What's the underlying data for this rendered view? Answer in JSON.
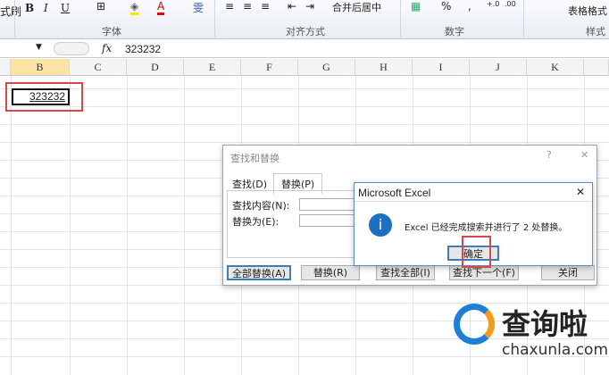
{
  "ribbon": {
    "bold": "B",
    "italic": "I",
    "underline": "U",
    "brush_tail": "式刷",
    "merge_center": "合并后居中",
    "percent": "%",
    "comma": ",",
    "table_format": "表格格式",
    "groups": {
      "font": "字体",
      "alignment": "对齐方式",
      "number": "数字",
      "styles": "样式"
    }
  },
  "formula_bar": {
    "fx": "fx",
    "value": "323232"
  },
  "columns": [
    "B",
    "C",
    "D",
    "E",
    "F",
    "G",
    "H",
    "I",
    "J",
    "K"
  ],
  "cell_B": {
    "value": "323232"
  },
  "find_replace": {
    "title": "查找和替换",
    "help": "?",
    "close": "✕",
    "tabs": [
      "查找(D)",
      "替换(P)"
    ],
    "find_label": "查找内容(N):",
    "replace_label": "替换为(E):",
    "buttons": [
      "全部替换(A)",
      "替换(R)",
      "查找全部(I)",
      "查找下一个(F)",
      "关闭"
    ]
  },
  "msgbox": {
    "title": "Microsoft Excel",
    "close": "✕",
    "message": "Excel 已经完成搜索并进行了 2 处替换。",
    "ok": "确定",
    "icon": "i"
  },
  "watermark": {
    "brand": "查询啦",
    "url": "chaxunla.com"
  }
}
